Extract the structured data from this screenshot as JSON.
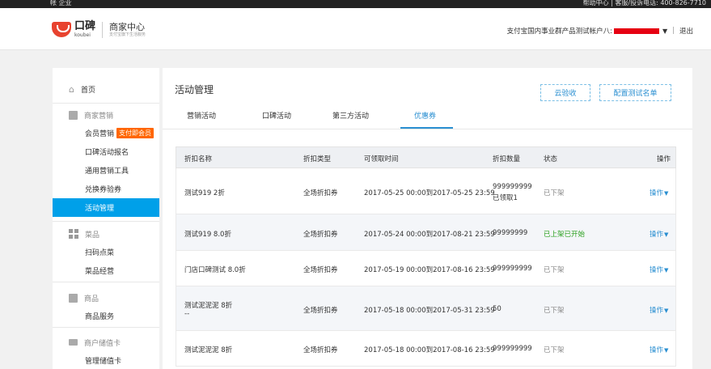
{
  "topbar": {
    "left_text": "帐   企业",
    "right_text": "帮助中心 | 客服/投诉电话: 400-826-7710"
  },
  "header": {
    "logo_cn": "口碑",
    "logo_en": "koubei",
    "logo_sub_title": "商家中心",
    "logo_sub_desc": "支付宝旗下生活服务",
    "account_label": "支付宝国内事业群产品测试帐户八:",
    "logout": "退出"
  },
  "sidebar": {
    "home": "首页",
    "marketing": "商家营销",
    "marketing_items": [
      "会员营销",
      "口碑活动报名",
      "通用营销工具",
      "兑换券验券",
      "活动管理"
    ],
    "badge": "支付即会员",
    "dishes": "菜品",
    "dishes_items": [
      "扫码点菜",
      "菜品经营"
    ],
    "goods": "商品",
    "goods_items": [
      "商品服务"
    ],
    "card": "商户储值卡",
    "card_items": [
      "管理储值卡"
    ]
  },
  "main": {
    "title": "活动管理",
    "btn_inspect": "云验收",
    "btn_config": "配置测试名单",
    "tabs": [
      "营销活动",
      "口碑活动",
      "第三方活动",
      "优惠券"
    ],
    "active_tab": "优惠券"
  },
  "table": {
    "headers": [
      "折扣名称",
      "折扣类型",
      "可领取时间",
      "折扣数量",
      "状态",
      "操作"
    ],
    "rows": [
      {
        "name": "测试919 2折",
        "name2": "",
        "type": "全场折扣券",
        "time": "2017-05-25 00:00到2017-05-25 23:59",
        "qty": "999999999",
        "qty2": "已领取1",
        "status": "已下架",
        "status_green": false,
        "op": "操作"
      },
      {
        "name": "测试919 8.0折",
        "name2": "",
        "type": "全场折扣券",
        "time": "2017-05-24 00:00到2017-08-21 23:59",
        "qty": "99999999",
        "qty2": "",
        "status": "已上架已开始",
        "status_green": true,
        "op": "操作"
      },
      {
        "name": "门店口碑测试 8.0折",
        "name2": "",
        "type": "全场折扣券",
        "time": "2017-05-19 00:00到2017-08-16 23:59",
        "qty": "999999999",
        "qty2": "",
        "status": "已下架",
        "status_green": false,
        "op": "操作"
      },
      {
        "name": "测试泥泥泥 8折",
        "name2": "--",
        "type": "全场折扣券",
        "time": "2017-05-18 00:00到2017-05-31 23:59",
        "qty": "50",
        "qty2": "",
        "status": "已下架",
        "status_green": false,
        "op": "操作"
      },
      {
        "name": "测试泥泥泥 8折",
        "name2": "",
        "type": "全场折扣券",
        "time": "2017-05-18 00:00到2017-08-16 23:59",
        "qty": "999999999",
        "qty2": "",
        "status": "已下架",
        "status_green": false,
        "op": "操作"
      }
    ]
  },
  "colors": {
    "accent": "#00a0e9",
    "link": "#2a8fd1",
    "badge": "#ff6600",
    "brand": "#e8432f",
    "online": "#2aa01e"
  }
}
